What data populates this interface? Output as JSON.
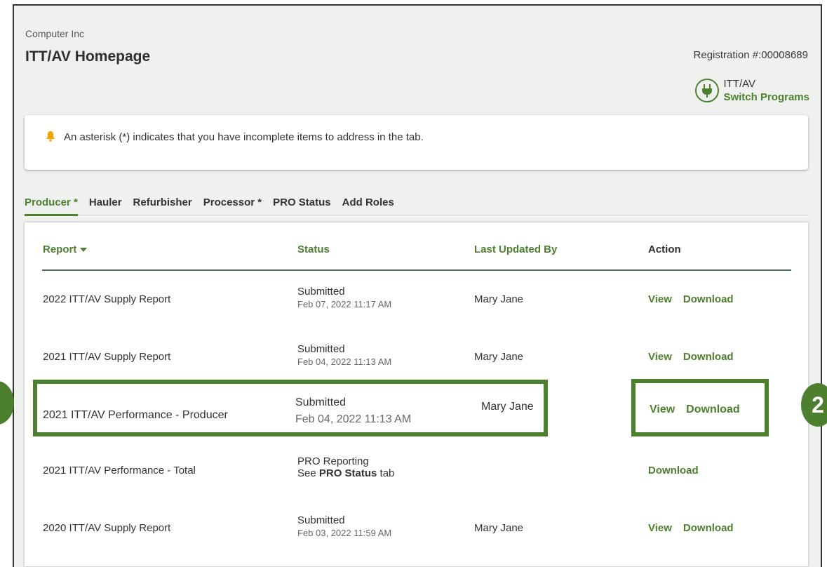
{
  "header": {
    "company": "Computer Inc",
    "title": "ITT/AV Homepage",
    "registration": "Registration #:00008689",
    "program_name": "ITT/AV",
    "switch_label": "Switch Programs"
  },
  "alert": {
    "message": "An asterisk (*) indicates that you have incomplete items to address in the tab."
  },
  "tabs": [
    {
      "label": "Producer *",
      "active": true
    },
    {
      "label": "Hauler"
    },
    {
      "label": "Refurbisher"
    },
    {
      "label": "Processor *"
    },
    {
      "label": "PRO Status"
    },
    {
      "label": "Add Roles"
    }
  ],
  "table": {
    "columns": {
      "report": "Report",
      "status": "Status",
      "updated_by": "Last Updated By",
      "action": "Action"
    },
    "rows": [
      {
        "report": "2022 ITT/AV Supply Report",
        "status": "Submitted",
        "date": "Feb 07, 2022 11:17 AM",
        "user": "Mary Jane",
        "view": "View",
        "download": "Download"
      },
      {
        "report": "2021 ITT/AV Supply Report",
        "status": "Submitted",
        "date": "Feb 04, 2022 11:13 AM",
        "user": "Mary Jane",
        "view": "View",
        "download": "Download"
      },
      {
        "report": "2021 ITT/AV Performance - Producer",
        "status": "Submitted",
        "date": "Feb 04, 2022 11:13 AM",
        "user": "Mary Jane",
        "view": "View",
        "download": "Download"
      },
      {
        "report": "2021 ITT/AV Performance - Total",
        "status": "PRO Reporting",
        "status_note_prefix": "See ",
        "status_note_bold": "PRO Status",
        "status_note_suffix": " tab",
        "user": "",
        "download": "Download"
      },
      {
        "report": "2020 ITT/AV Supply Report",
        "status": "Submitted",
        "date": "Feb 03, 2022 11:59 AM",
        "user": "Mary Jane",
        "view": "View",
        "download": "Download"
      }
    ]
  },
  "annotations": {
    "step_2": "2"
  },
  "colors": {
    "accent": "#4c7f2e",
    "alert_icon": "#f0a500"
  }
}
